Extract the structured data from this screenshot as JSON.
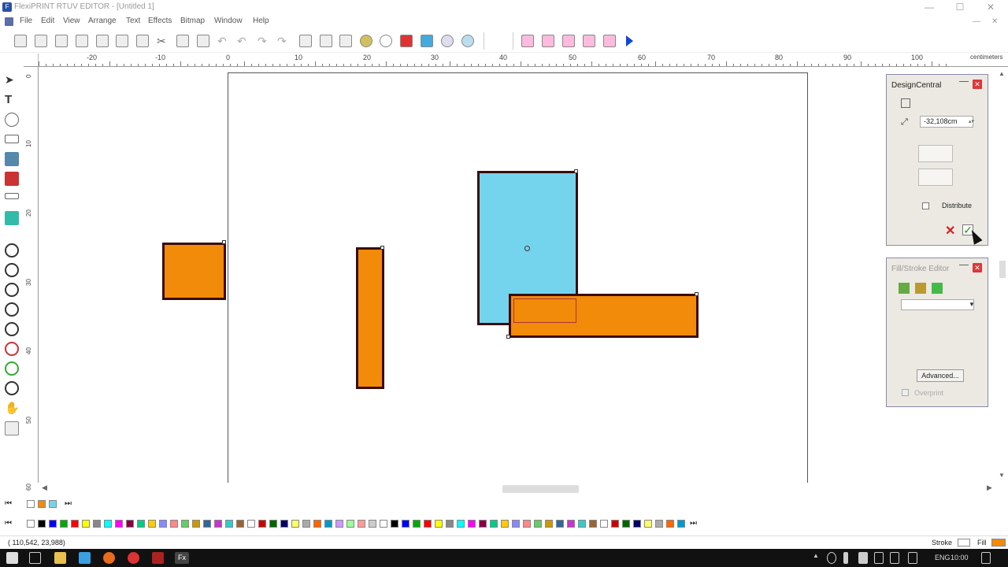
{
  "window": {
    "title": "FlexiPRINT RTUV EDITOR - [Untitled 1]",
    "min": "—",
    "max": "☐",
    "close": "✕"
  },
  "menu": [
    "File",
    "Edit",
    "View",
    "Arrange",
    "Text",
    "Effects",
    "Bitmap",
    "Window",
    "Help"
  ],
  "ruler": {
    "labels": [
      "-20",
      "-10",
      "0",
      "10",
      "20",
      "30",
      "40",
      "50",
      "60",
      "70",
      "80",
      "90",
      "100"
    ],
    "unit": "centimeters",
    "left_labels": [
      "0",
      "10",
      "20",
      "30",
      "40",
      "50",
      "60"
    ]
  },
  "design_central": {
    "title": "DesignCentral",
    "value": "-32,108cm",
    "distribute_label": "Distribute",
    "cancel_glyph": "✕",
    "apply_glyph": "✓"
  },
  "fill_stroke": {
    "title": "Fill/Stroke Editor",
    "advanced_label": "Advanced...",
    "overprint_label": "Overprint"
  },
  "status": {
    "coords": "( 110,542,    23,988)",
    "stroke_label": "Stroke",
    "fill_label": "Fill"
  },
  "taskbar": {
    "lang": "ENG",
    "time": "10:00"
  },
  "colors": {
    "orange": "#f28a0a",
    "blue": "#74d4ee",
    "outline": "#3a0c0c",
    "panel": "#ece9e3"
  }
}
